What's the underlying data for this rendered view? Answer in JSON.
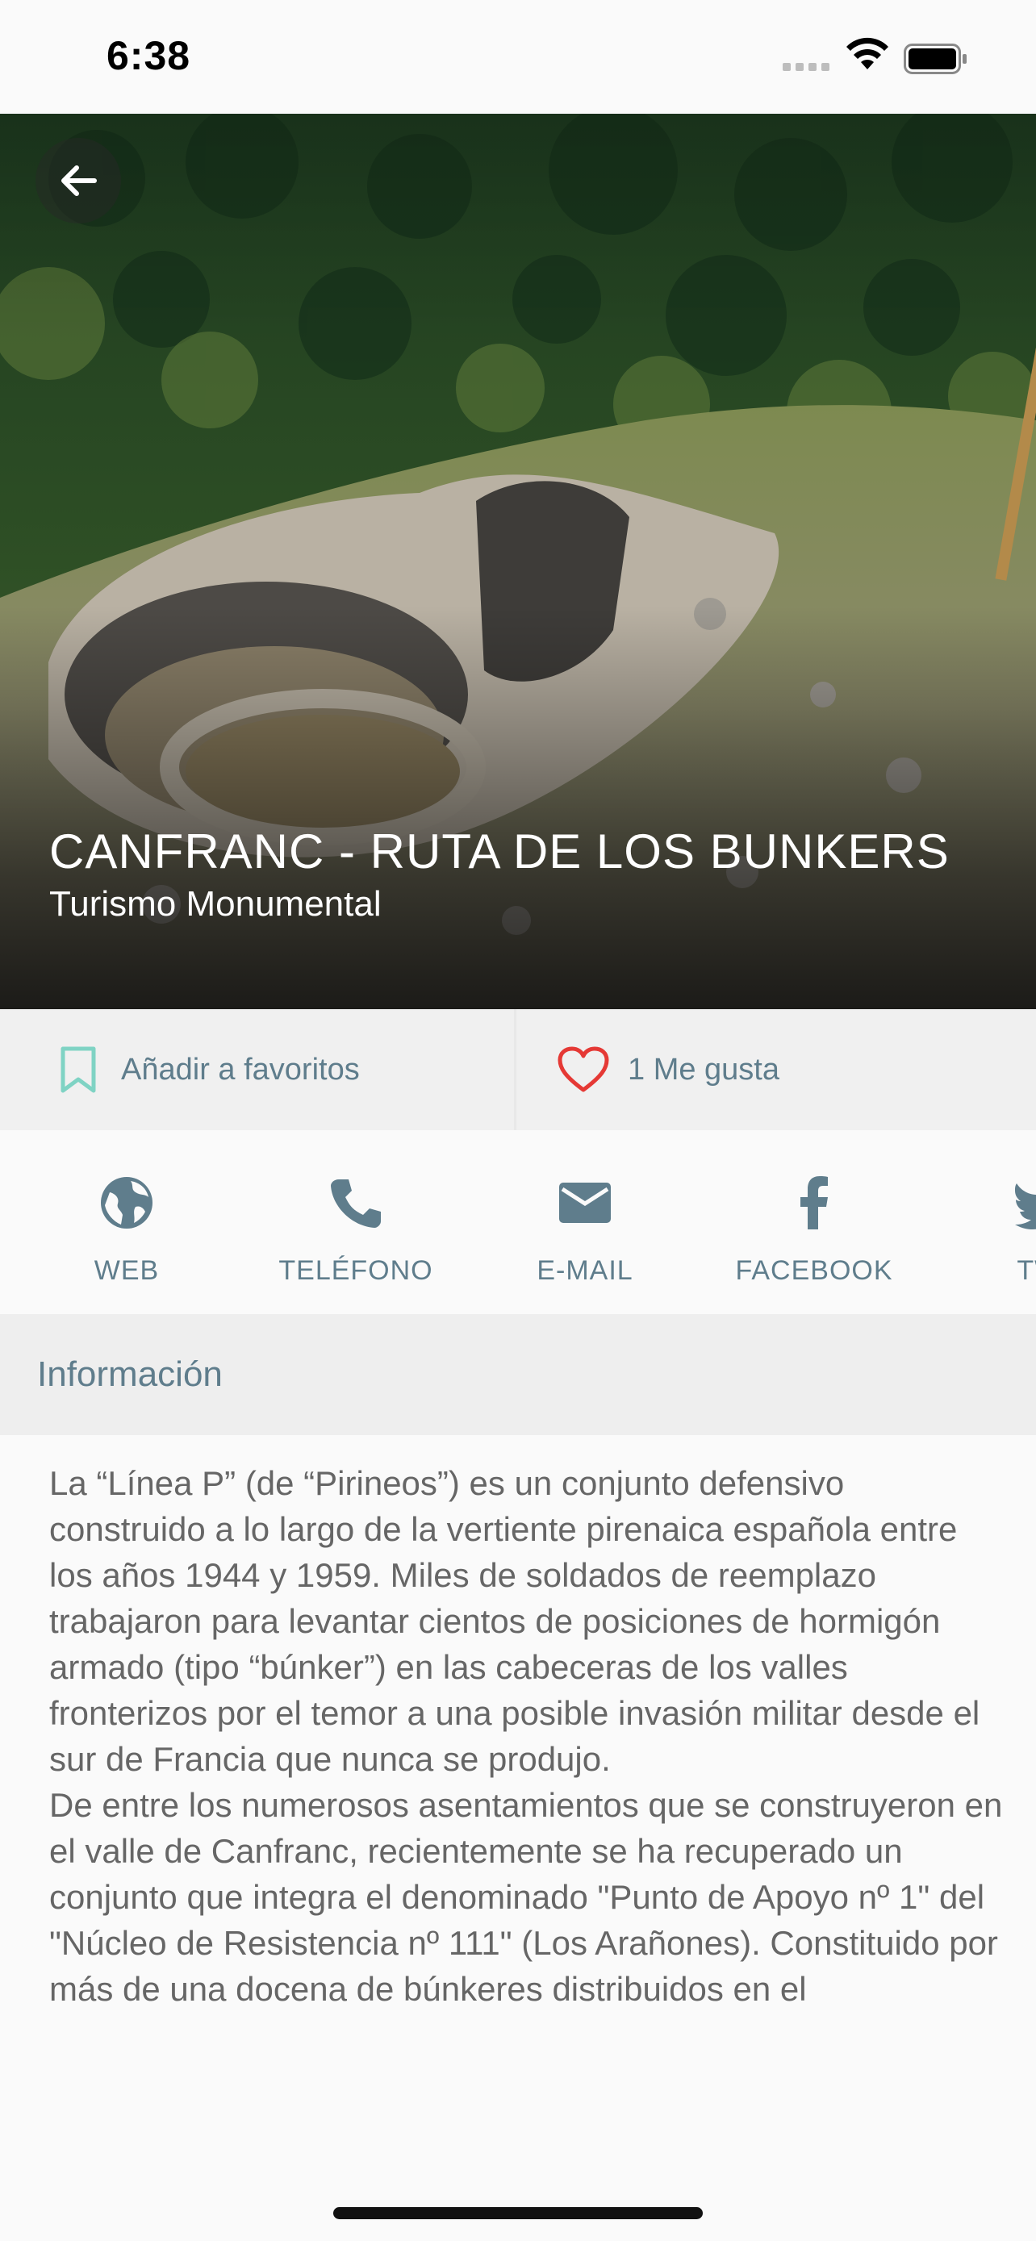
{
  "status_bar": {
    "time": "6:38"
  },
  "hero": {
    "title": "CANFRANC - RUTA DE LOS BUNKERS",
    "subtitle": "Turismo Monumental",
    "back_icon": "arrow-left-icon"
  },
  "actions": {
    "favorite_label": "Añadir a favoritos",
    "favorite_icon": "bookmark-icon",
    "like_label": "1 Me gusta",
    "like_icon": "heart-icon"
  },
  "contacts": [
    {
      "label": "WEB",
      "icon": "globe-icon"
    },
    {
      "label": "TELÉFONO",
      "icon": "phone-icon"
    },
    {
      "label": "E-MAIL",
      "icon": "mail-icon"
    },
    {
      "label": "FACEBOOK",
      "icon": "facebook-icon"
    },
    {
      "label": "TWI",
      "icon": "twitter-icon"
    }
  ],
  "info": {
    "section_title": "Información",
    "paragraph_1": "La “Línea P” (de “Pirineos”) es un conjunto defensivo construido a lo largo de la vertiente pirenaica española entre los años 1944 y 1959. Miles de soldados de reemplazo trabajaron para levantar cientos de posiciones de hormigón armado (tipo “búnker”) en las cabeceras de los valles fronterizos por el temor a una posible invasión militar desde el sur de Francia que nunca se produjo.",
    "paragraph_2": "De entre los numerosos asentamientos que se construyeron en el valle de Canfranc, recientemente se ha recuperado un conjunto que integra el denominado \"Punto de Apoyo nº 1\" del \"Núcleo de Resistencia nº 111\" (Los Arañones). Constituido por más de una docena de búnkeres distribuidos en el"
  },
  "colors": {
    "accent": "#5f7d8c",
    "bookmark": "#7fd3c4",
    "heart": "#e53935",
    "background": "#fafafa"
  }
}
